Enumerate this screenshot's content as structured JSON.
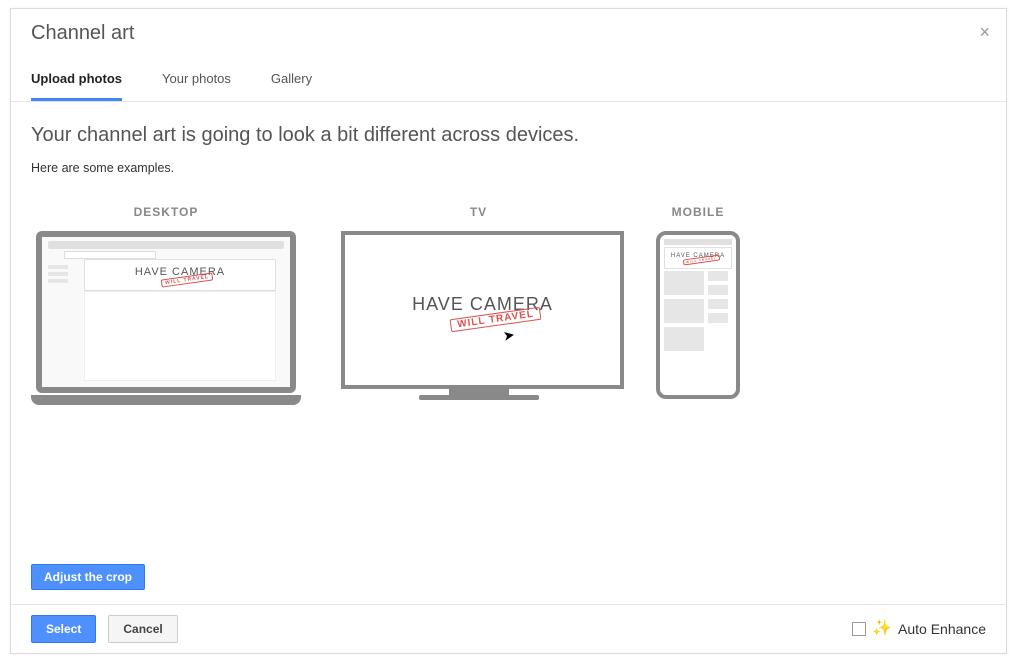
{
  "dialog": {
    "title": "Channel art",
    "close_symbol": "×"
  },
  "tabs": {
    "upload": "Upload photos",
    "your_photos": "Your photos",
    "gallery": "Gallery"
  },
  "content": {
    "headline": "Your channel art is going to look a bit different across devices.",
    "subline": "Here are some examples."
  },
  "devices": {
    "desktop_label": "DESKTOP",
    "tv_label": "TV",
    "mobile_label": "MOBILE"
  },
  "logo": {
    "main": "HAVE CAMERA",
    "stamp": "WILL TRAVEL"
  },
  "buttons": {
    "adjust_crop": "Adjust the crop",
    "select": "Select",
    "cancel": "Cancel"
  },
  "footer": {
    "auto_enhance": "Auto Enhance"
  }
}
